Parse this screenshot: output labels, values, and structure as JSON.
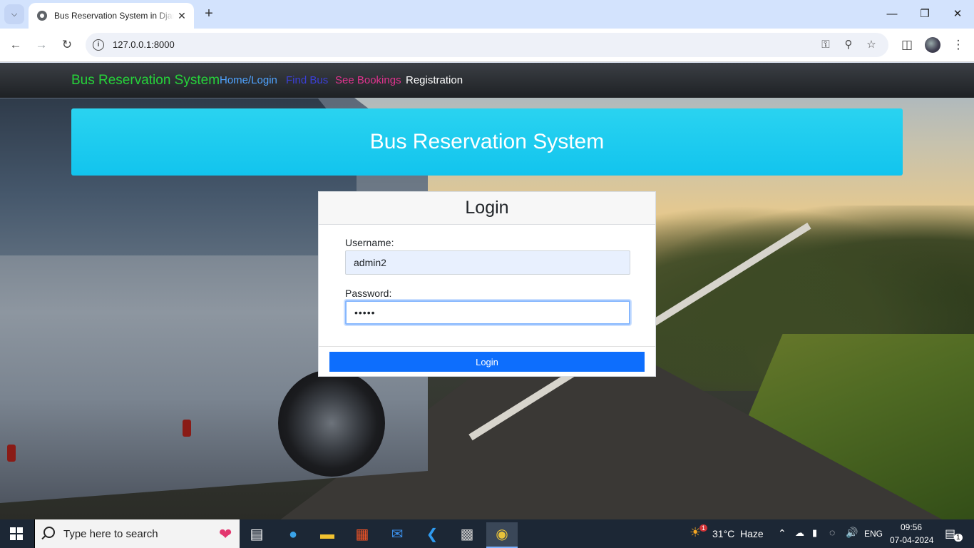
{
  "browser": {
    "tab_title": "Bus Reservation System in Django",
    "new_tab_symbol": "+",
    "url": "127.0.0.1:8000"
  },
  "navbar": {
    "brand": "Bus Reservation System",
    "links": [
      {
        "label": "Home/Login",
        "color": "#4fa3ff"
      },
      {
        "label": "Find Bus",
        "color": "#3b3fd6"
      },
      {
        "label": "See Bookings",
        "color": "#e0338e"
      },
      {
        "label": "Registration",
        "color": "#ffffff"
      }
    ]
  },
  "hero": {
    "title": "Bus Reservation System"
  },
  "login": {
    "title": "Login",
    "username_label": "Username:",
    "username_value": "admin2",
    "password_label": "Password:",
    "password_value": "•••••",
    "button_label": "Login"
  },
  "taskbar": {
    "search_placeholder": "Type here to search",
    "weather_temp": "31°C",
    "weather_desc": "Haze",
    "weather_badge": "1",
    "language": "ENG",
    "time": "09:56",
    "date": "07-04-2024",
    "notification_count": "1"
  },
  "colors": {
    "primary_button": "#0d6efd",
    "hero": "#1ccbf0",
    "brand": "#26d33a"
  }
}
